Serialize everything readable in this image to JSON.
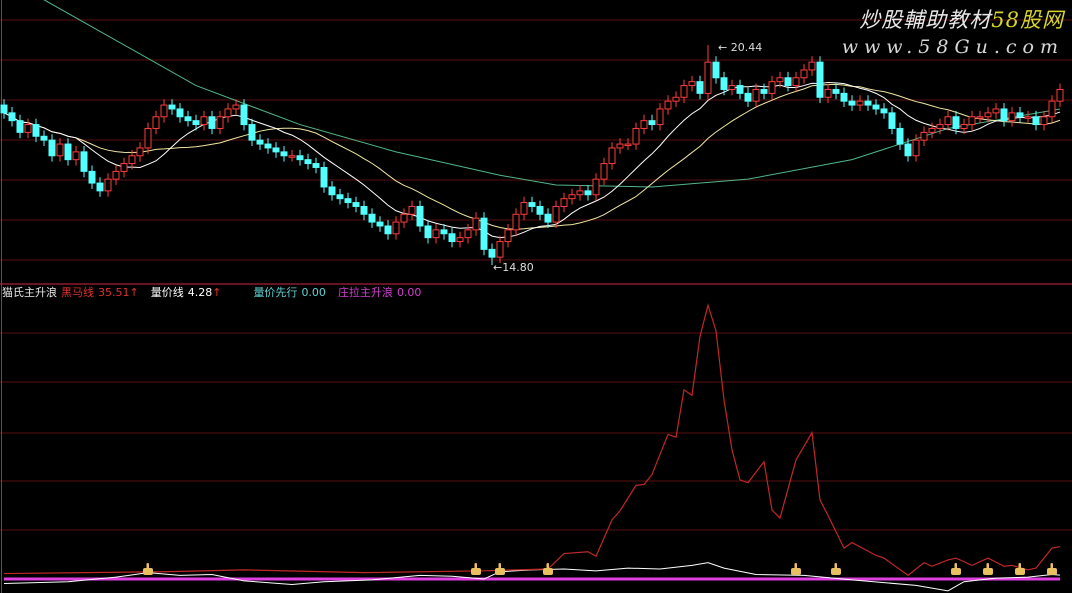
{
  "watermark": {
    "title": "炒股輔助教材",
    "brand": "58股网",
    "url": "www.58Gu.com"
  },
  "legend": {
    "indicator_name": "猫氏主升浪",
    "items": [
      {
        "label": "黑马线",
        "value": "35.51",
        "arrow": "↑",
        "color": "#e03030"
      },
      {
        "label": "量价线",
        "value": "4.28",
        "arrow": "↑",
        "color": "#ffffff"
      },
      {
        "label": "量价先行",
        "value": "0.00",
        "arrow": "",
        "color": "#5fd3d3"
      },
      {
        "label": "庄拉主升浪",
        "value": "0.00",
        "arrow": "",
        "color": "#d040d0"
      }
    ]
  },
  "colors": {
    "up": "#ff3c3c",
    "down": "#54ffff",
    "ma5": "#ffffff",
    "ma10": "#f0e6a0",
    "ma_long": "#4fb88a",
    "grid": "#3a0a0a",
    "divider": "#8a1a2a",
    "black_horse": "#c02828",
    "volume_price": "#ffffff",
    "main_wave": "#e040e0",
    "signal": "#e8c060"
  },
  "chart_data": [
    {
      "type": "candlestick",
      "title": "price",
      "annotations": {
        "high_label": "20.44",
        "high": 20.44,
        "high_index": 88,
        "low_label": "14.80",
        "low": 14.8,
        "low_index": 61
      },
      "ylim": [
        14.4,
        21.6
      ],
      "first_open": 18.9,
      "close": [
        18.7,
        18.5,
        18.2,
        18.4,
        18.1,
        18.0,
        17.6,
        17.9,
        17.5,
        17.7,
        17.2,
        16.9,
        16.7,
        17.0,
        17.2,
        17.4,
        17.6,
        17.8,
        18.3,
        18.6,
        18.9,
        18.8,
        18.6,
        18.5,
        18.4,
        18.6,
        18.3,
        18.6,
        18.8,
        18.9,
        18.4,
        18.0,
        17.9,
        17.8,
        17.7,
        17.6,
        17.6,
        17.5,
        17.4,
        17.3,
        16.8,
        16.6,
        16.5,
        16.4,
        16.3,
        16.1,
        15.9,
        15.8,
        15.6,
        15.9,
        16.1,
        16.3,
        15.8,
        15.5,
        15.7,
        15.6,
        15.4,
        15.5,
        15.7,
        16.0,
        15.2,
        15.0,
        15.4,
        15.7,
        16.1,
        16.4,
        16.3,
        16.1,
        15.9,
        16.3,
        16.5,
        16.6,
        16.7,
        16.6,
        17.0,
        17.4,
        17.8,
        17.9,
        17.9,
        18.3,
        18.5,
        18.4,
        18.8,
        19.0,
        19.1,
        19.4,
        19.5,
        19.2,
        20.0,
        19.6,
        19.3,
        19.4,
        19.2,
        19.0,
        19.3,
        19.2,
        19.5,
        19.6,
        19.4,
        19.6,
        19.8,
        20.0,
        19.1,
        19.3,
        19.2,
        19.0,
        18.9,
        19.0,
        18.9,
        18.8,
        18.7,
        18.3,
        17.9,
        17.6,
        18.0,
        18.2,
        18.3,
        18.4,
        18.6,
        18.3,
        18.4,
        18.6,
        18.6,
        18.7,
        18.8,
        18.5,
        18.7,
        18.6,
        18.6,
        18.4,
        18.6,
        19.0,
        19.3
      ],
      "ma_long": [
        [
          0,
          22.1
        ],
        [
          5,
          21.6
        ],
        [
          24,
          19.4
        ],
        [
          37,
          18.4
        ],
        [
          49,
          17.7
        ],
        [
          62,
          17.1
        ],
        [
          69,
          16.85
        ],
        [
          81,
          16.8
        ],
        [
          93,
          17.0
        ],
        [
          106,
          17.5
        ],
        [
          118,
          18.3
        ],
        [
          132,
          18.8
        ]
      ]
    },
    {
      "type": "line",
      "title": "猫氏主升浪",
      "ylim": [
        -10,
        320
      ],
      "series": [
        {
          "name": "黑马线",
          "points": [
            [
              0,
              6
            ],
            [
              20,
              8
            ],
            [
              30,
              10
            ],
            [
              45,
              7
            ],
            [
              60,
              9
            ],
            [
              68,
              11
            ],
            [
              70,
              28
            ],
            [
              73,
              30
            ],
            [
              74,
              25
            ],
            [
              76,
              65
            ],
            [
              77,
              75
            ],
            [
              79,
              103
            ],
            [
              80,
              104
            ],
            [
              81,
              115
            ],
            [
              83,
              159
            ],
            [
              84,
              156
            ],
            [
              85,
              208
            ],
            [
              86,
              202
            ],
            [
              87,
              267
            ],
            [
              88,
              301
            ],
            [
              89,
              273
            ],
            [
              90,
              197
            ],
            [
              91,
              142
            ],
            [
              92,
              109
            ],
            [
              93,
              106
            ],
            [
              95,
              129
            ],
            [
              96,
              76
            ],
            [
              97,
              67
            ],
            [
              99,
              131
            ],
            [
              101,
              161
            ],
            [
              102,
              87
            ],
            [
              103,
              70
            ],
            [
              105,
              34
            ],
            [
              106,
              40
            ],
            [
              109,
              26
            ],
            [
              110,
              23
            ],
            [
              113,
              4
            ],
            [
              115,
              18
            ],
            [
              116,
              14
            ],
            [
              118,
              21
            ],
            [
              119,
              23
            ],
            [
              121,
              15
            ],
            [
              123,
              23
            ],
            [
              125,
              14
            ],
            [
              126,
              15
            ],
            [
              128,
              10
            ],
            [
              129,
              12
            ],
            [
              131,
              34
            ],
            [
              132,
              35.51
            ]
          ]
        },
        {
          "name": "量价线",
          "points": [
            [
              0,
              -5
            ],
            [
              8,
              -3
            ],
            [
              14,
              2
            ],
            [
              18,
              7
            ],
            [
              22,
              4
            ],
            [
              26,
              5
            ],
            [
              30,
              -2
            ],
            [
              36,
              -6
            ],
            [
              40,
              -3
            ],
            [
              46,
              -1
            ],
            [
              52,
              4
            ],
            [
              56,
              3
            ],
            [
              60,
              0
            ],
            [
              62,
              8
            ],
            [
              66,
              10
            ],
            [
              70,
              11
            ],
            [
              74,
              9
            ],
            [
              78,
              12
            ],
            [
              82,
              11
            ],
            [
              86,
              15
            ],
            [
              88,
              18
            ],
            [
              90,
              12
            ],
            [
              94,
              5
            ],
            [
              100,
              4
            ],
            [
              106,
              -1
            ],
            [
              110,
              -4
            ],
            [
              114,
              -7
            ],
            [
              118,
              -13
            ],
            [
              120,
              -3
            ],
            [
              124,
              1
            ],
            [
              128,
              2
            ],
            [
              131,
              5
            ],
            [
              132,
              4.28
            ]
          ]
        },
        {
          "name": "庄拉主升浪",
          "points": [
            [
              0,
              0
            ],
            [
              132,
              0
            ]
          ]
        }
      ],
      "signals": [
        18,
        59,
        62,
        68,
        99,
        104,
        119,
        123,
        127,
        131
      ]
    }
  ]
}
